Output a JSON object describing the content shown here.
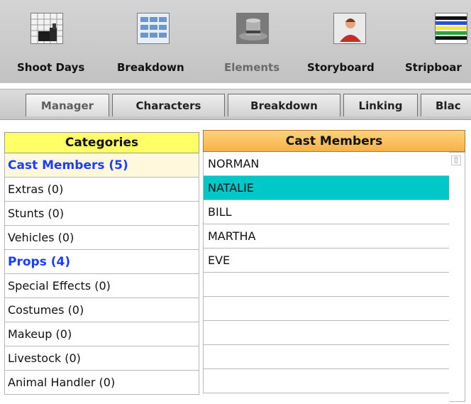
{
  "toolbar": {
    "items": [
      {
        "label": "Shoot Days",
        "icon": "calendar-icon"
      },
      {
        "label": "Breakdown",
        "icon": "breakdown-sheet-icon"
      },
      {
        "label": "Elements",
        "icon": "top-hat-icon"
      },
      {
        "label": "Storyboard",
        "icon": "person-portrait-icon"
      },
      {
        "label": "Stripboar",
        "icon": "stripboard-icon"
      }
    ]
  },
  "tabs": [
    {
      "label": "Manager",
      "active": true
    },
    {
      "label": "Characters"
    },
    {
      "label": "Breakdown"
    },
    {
      "label": "Linking"
    },
    {
      "label": "Blac"
    }
  ],
  "categories": {
    "header": "Categories",
    "items": [
      {
        "label": "Cast Members (5)"
      },
      {
        "label": "Extras (0)"
      },
      {
        "label": "Stunts (0)"
      },
      {
        "label": "Vehicles (0)"
      },
      {
        "label": "Props (4)"
      },
      {
        "label": "Special Effects (0)"
      },
      {
        "label": "Costumes (0)"
      },
      {
        "label": "Makeup (0)"
      },
      {
        "label": "Livestock (0)"
      },
      {
        "label": "Animal Handler (0)"
      }
    ]
  },
  "cast": {
    "header": "Cast Members",
    "members": [
      "NORMAN",
      "NATALIE",
      "BILL",
      "MARTHA",
      "EVE",
      "",
      "",
      "",
      "",
      ""
    ],
    "selected": "NATALIE"
  },
  "colors": {
    "category_header": "#ffff66",
    "cast_header": "#f6b24a",
    "selected_row": "#00c8c8",
    "highlight_text": "#1a3cff"
  },
  "scrollbar": {
    "up_arrow_icon": "chevron-up-icon"
  }
}
